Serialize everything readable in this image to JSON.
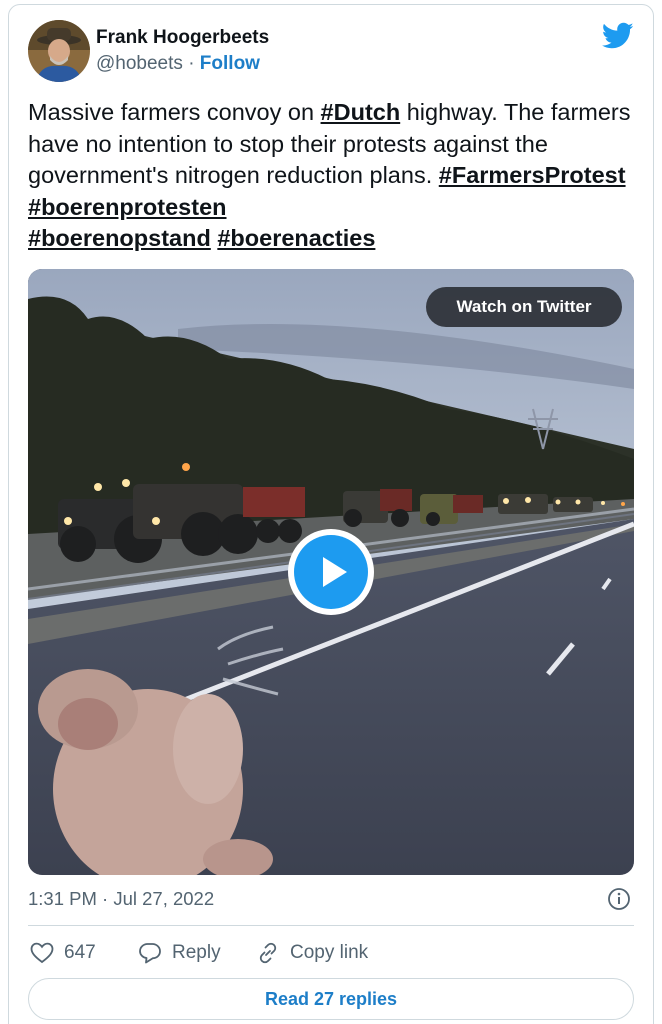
{
  "author": {
    "name": "Frank Hoogerbeets",
    "handle": "@hobeets",
    "separator": "·",
    "follow_label": "Follow"
  },
  "tweet": {
    "text_parts": [
      "Massive farmers convoy on ",
      "#Dutch",
      " highway. The farmers have no intention to stop their protests against the government's nitrogen reduction plans. ",
      "#FarmersProtest",
      " ",
      "#boerenprotesten",
      " ",
      "#boerenopstand",
      " ",
      "#boerenacties"
    ]
  },
  "media": {
    "watch_label": "Watch on Twitter",
    "type": "video"
  },
  "meta": {
    "timestamp": "1:31 PM · Jul 27, 2022"
  },
  "actions": {
    "like_count": "647",
    "reply_label": "Reply",
    "copy_label": "Copy link"
  },
  "footer": {
    "read_replies_label": "Read 27 replies"
  },
  "colors": {
    "accent": "#1d9bf0",
    "link": "#1d7ec8",
    "secondary_text": "#536471",
    "border": "#cfd9de"
  },
  "icons": [
    "twitter-bird-icon",
    "play-icon",
    "info-icon",
    "heart-icon",
    "reply-bubble-icon",
    "link-icon"
  ]
}
